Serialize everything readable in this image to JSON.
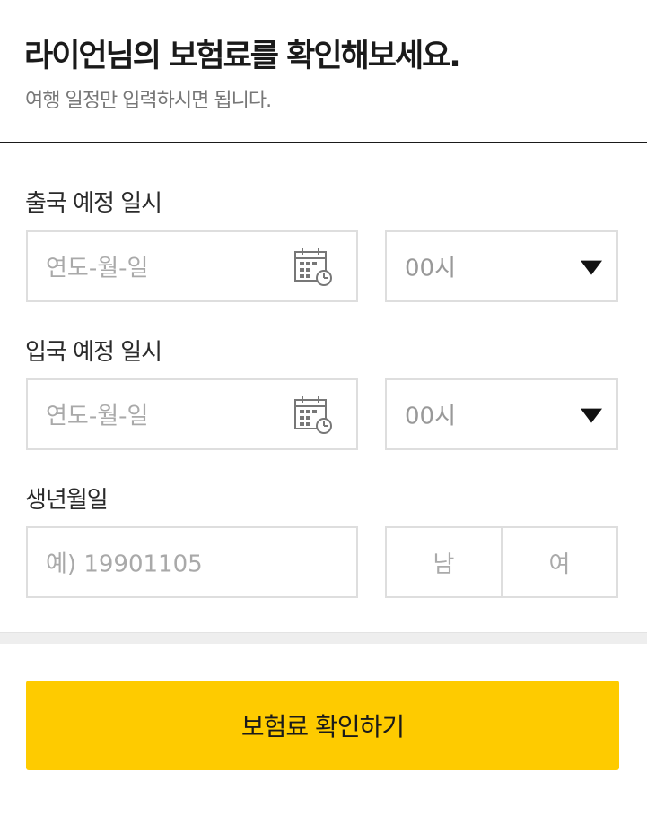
{
  "header": {
    "title": "라이언님의 보험료를 확인해보세요.",
    "subtitle": "여행 일정만 입력하시면 됩니다."
  },
  "departure": {
    "label": "출국 예정 일시",
    "date_placeholder": "연도-월-일",
    "hour_value": "00시"
  },
  "arrival": {
    "label": "입국 예정 일시",
    "date_placeholder": "연도-월-일",
    "hour_value": "00시"
  },
  "birth": {
    "label": "생년월일",
    "placeholder": "예) 19901105",
    "gender_options": [
      "남",
      "여"
    ]
  },
  "submit": {
    "label": "보험료 확인하기"
  },
  "colors": {
    "accent": "#fecb00",
    "border": "#dedede",
    "placeholder": "#a9a9a9"
  },
  "icons": {
    "calendar": "calendar-icon",
    "dropdown": "dropdown-caret-icon"
  }
}
